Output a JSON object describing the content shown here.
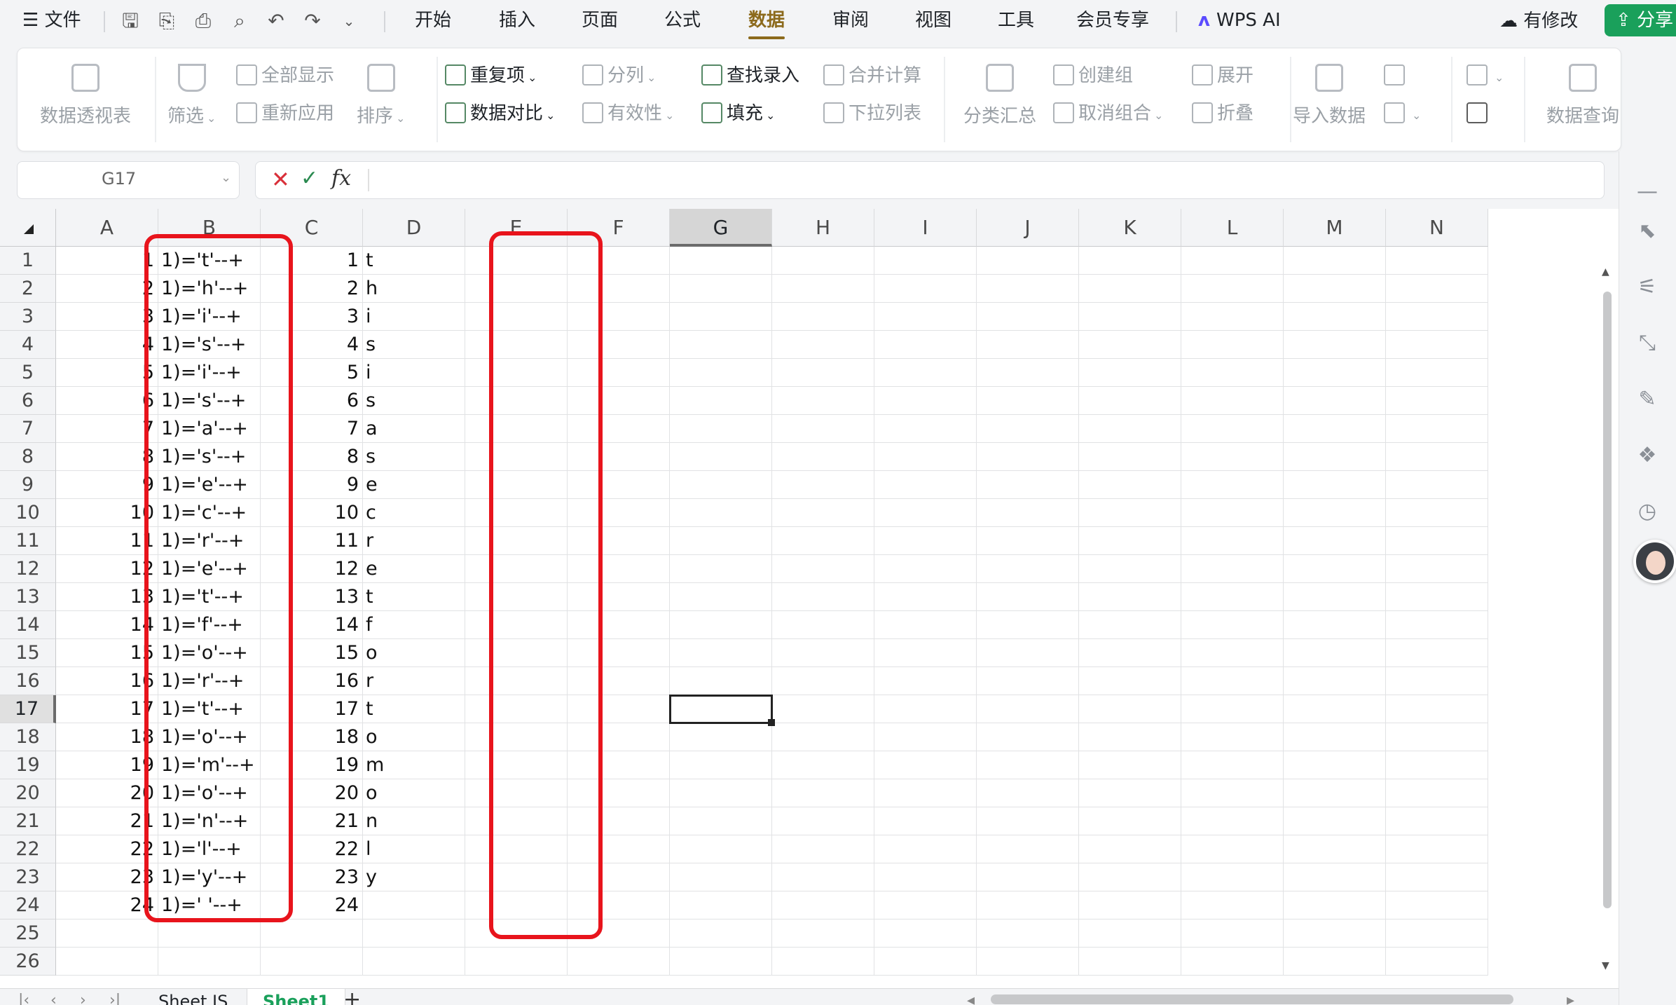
{
  "menu": {
    "file_label": "文件",
    "tabs": [
      "开始",
      "插入",
      "页面",
      "公式",
      "数据",
      "审阅",
      "视图",
      "工具",
      "会员专享"
    ],
    "active_tab": "数据",
    "wps_ai": "WPS AI",
    "modified": "有修改",
    "share": "分享"
  },
  "ribbon": {
    "pivot": "数据透视表",
    "filter": "筛选",
    "show_all": "全部显示",
    "reapply": "重新应用",
    "sort": "排序",
    "duplicates": "重复项",
    "compare": "数据对比",
    "split": "分列",
    "validity": "有效性",
    "find_entry": "查找录入",
    "fill": "填充",
    "consolidate": "合并计算",
    "dropdown_list": "下拉列表",
    "subtotal": "分类汇总",
    "create_group": "创建组",
    "ungroup": "取消组合",
    "expand": "展开",
    "collapse": "折叠",
    "import_data": "导入数据",
    "data_query": "数据查询"
  },
  "formula_bar": {
    "name_box": "G17",
    "fx": "fx",
    "content": ""
  },
  "columns": [
    "A",
    "B",
    "C",
    "D",
    "E",
    "F",
    "G",
    "H",
    "I",
    "J",
    "K",
    "L",
    "M",
    "N"
  ],
  "selected_column": "G",
  "selected_row": "17",
  "rows": [
    {
      "n": "1",
      "a": "1",
      "b": "1)='t'--+",
      "c": "1",
      "d": "t"
    },
    {
      "n": "2",
      "a": "2",
      "b": "1)='h'--+",
      "c": "2",
      "d": "h"
    },
    {
      "n": "3",
      "a": "3",
      "b": "1)='i'--+",
      "c": "3",
      "d": "i"
    },
    {
      "n": "4",
      "a": "4",
      "b": "1)='s'--+",
      "c": "4",
      "d": "s"
    },
    {
      "n": "5",
      "a": "5",
      "b": "1)='i'--+",
      "c": "5",
      "d": "i"
    },
    {
      "n": "6",
      "a": "6",
      "b": "1)='s'--+",
      "c": "6",
      "d": "s"
    },
    {
      "n": "7",
      "a": "7",
      "b": "1)='a'--+",
      "c": "7",
      "d": "a"
    },
    {
      "n": "8",
      "a": "8",
      "b": "1)='s'--+",
      "c": "8",
      "d": "s"
    },
    {
      "n": "9",
      "a": "9",
      "b": "1)='e'--+",
      "c": "9",
      "d": "e"
    },
    {
      "n": "10",
      "a": "10",
      "b": "1)='c'--+",
      "c": "10",
      "d": "c"
    },
    {
      "n": "11",
      "a": "11",
      "b": "1)='r'--+",
      "c": "11",
      "d": "r"
    },
    {
      "n": "12",
      "a": "12",
      "b": "1)='e'--+",
      "c": "12",
      "d": "e"
    },
    {
      "n": "13",
      "a": "13",
      "b": "1)='t'--+",
      "c": "13",
      "d": "t"
    },
    {
      "n": "14",
      "a": "14",
      "b": "1)='f'--+",
      "c": "14",
      "d": "f"
    },
    {
      "n": "15",
      "a": "15",
      "b": "1)='o'--+",
      "c": "15",
      "d": "o"
    },
    {
      "n": "16",
      "a": "16",
      "b": "1)='r'--+",
      "c": "16",
      "d": "r"
    },
    {
      "n": "17",
      "a": "17",
      "b": "1)='t'--+",
      "c": "17",
      "d": "t"
    },
    {
      "n": "18",
      "a": "18",
      "b": "1)='o'--+",
      "c": "18",
      "d": "o"
    },
    {
      "n": "19",
      "a": "19",
      "b": "1)='m'--+",
      "c": "19",
      "d": "m"
    },
    {
      "n": "20",
      "a": "20",
      "b": "1)='o'--+",
      "c": "20",
      "d": "o"
    },
    {
      "n": "21",
      "a": "21",
      "b": "1)='n'--+",
      "c": "21",
      "d": "n"
    },
    {
      "n": "22",
      "a": "22",
      "b": "1)='l'--+",
      "c": "22",
      "d": "l"
    },
    {
      "n": "23",
      "a": "23",
      "b": "1)='y'--+",
      "c": "23",
      "d": "y"
    },
    {
      "n": "24",
      "a": "24",
      "b": "1)=' '--+",
      "c": "24",
      "d": ""
    },
    {
      "n": "25",
      "a": "",
      "b": "",
      "c": "",
      "d": ""
    },
    {
      "n": "26",
      "a": "",
      "b": "",
      "c": "",
      "d": ""
    }
  ],
  "sheets": [
    "Sheet IS",
    "Sheet1"
  ],
  "active_sheet": "Sheet1",
  "colors": {
    "accent": "#8c6a1c",
    "share": "#1aa05b",
    "highlight": "#e8141c"
  }
}
